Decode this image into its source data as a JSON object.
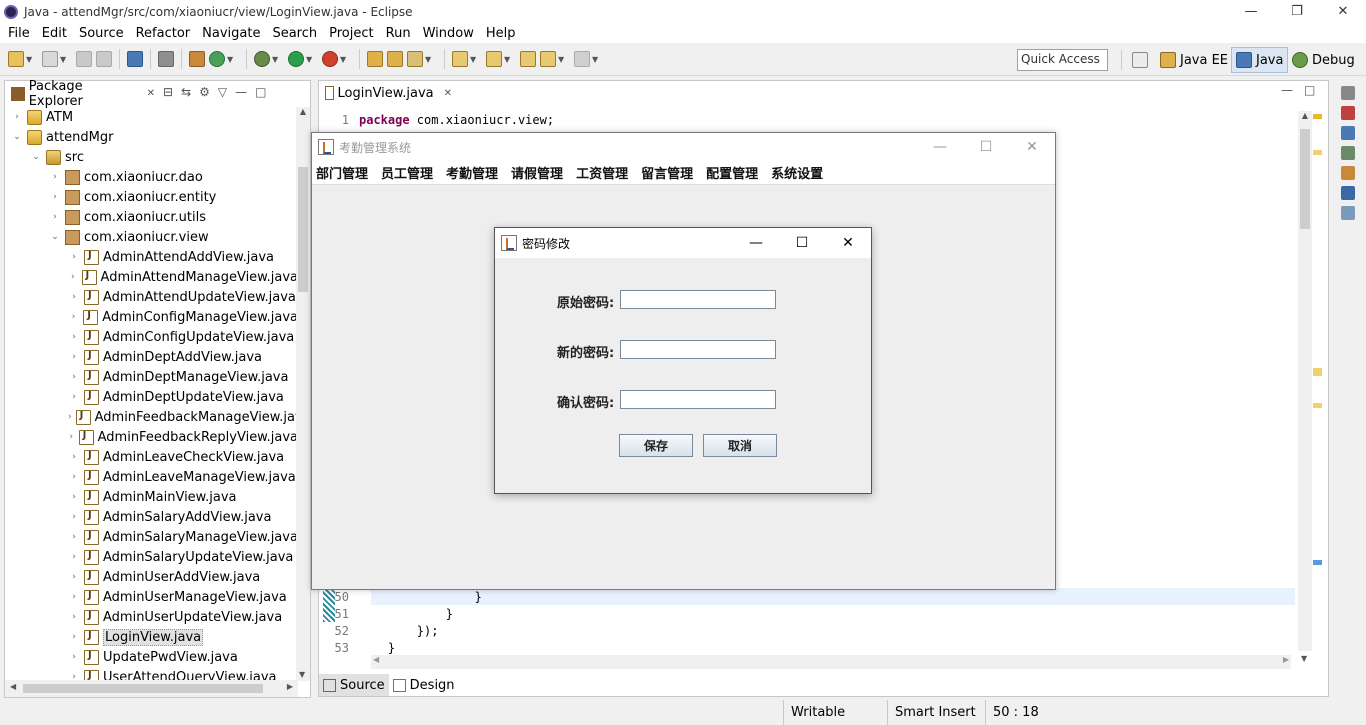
{
  "window": {
    "title": "Java - attendMgr/src/com/xiaoniucr/view/LoginView.java - Eclipse",
    "minimize": "—",
    "maximize": "❐",
    "close": "✕"
  },
  "menubar": [
    "File",
    "Edit",
    "Source",
    "Refactor",
    "Navigate",
    "Search",
    "Project",
    "Run",
    "Window",
    "Help"
  ],
  "toolbar": {
    "quick_access": "Quick Access"
  },
  "perspectives": [
    {
      "label": "Java EE"
    },
    {
      "label": "Java",
      "active": true
    },
    {
      "label": "Debug"
    }
  ],
  "package_explorer": {
    "tab_label": "Package Explorer",
    "tab_close": "✕",
    "tree": [
      {
        "label": "ATM",
        "type": "project",
        "level": 0,
        "expanded": false
      },
      {
        "label": "attendMgr",
        "type": "project",
        "level": 0,
        "expanded": true
      },
      {
        "label": "src",
        "type": "src",
        "level": 1,
        "expanded": true
      },
      {
        "label": "com.xiaoniucr.dao",
        "type": "package",
        "level": 2,
        "expanded": false
      },
      {
        "label": "com.xiaoniucr.entity",
        "type": "package",
        "level": 2,
        "expanded": false
      },
      {
        "label": "com.xiaoniucr.utils",
        "type": "package",
        "level": 2,
        "expanded": false
      },
      {
        "label": "com.xiaoniucr.view",
        "type": "package",
        "level": 2,
        "expanded": true
      },
      {
        "label": "AdminAttendAddView.java",
        "type": "java",
        "level": 3
      },
      {
        "label": "AdminAttendManageView.java",
        "type": "java",
        "level": 3
      },
      {
        "label": "AdminAttendUpdateView.java",
        "type": "java",
        "level": 3
      },
      {
        "label": "AdminConfigManageView.java",
        "type": "java",
        "level": 3
      },
      {
        "label": "AdminConfigUpdateView.java",
        "type": "java",
        "level": 3
      },
      {
        "label": "AdminDeptAddView.java",
        "type": "java",
        "level": 3
      },
      {
        "label": "AdminDeptManageView.java",
        "type": "java",
        "level": 3
      },
      {
        "label": "AdminDeptUpdateView.java",
        "type": "java",
        "level": 3
      },
      {
        "label": "AdminFeedbackManageView.jav",
        "type": "java",
        "level": 3
      },
      {
        "label": "AdminFeedbackReplyView.java",
        "type": "java",
        "level": 3
      },
      {
        "label": "AdminLeaveCheckView.java",
        "type": "java",
        "level": 3
      },
      {
        "label": "AdminLeaveManageView.java",
        "type": "java",
        "level": 3
      },
      {
        "label": "AdminMainView.java",
        "type": "java",
        "level": 3
      },
      {
        "label": "AdminSalaryAddView.java",
        "type": "java",
        "level": 3
      },
      {
        "label": "AdminSalaryManageView.java",
        "type": "java",
        "level": 3
      },
      {
        "label": "AdminSalaryUpdateView.java",
        "type": "java",
        "level": 3
      },
      {
        "label": "AdminUserAddView.java",
        "type": "java",
        "level": 3
      },
      {
        "label": "AdminUserManageView.java",
        "type": "java",
        "level": 3
      },
      {
        "label": "AdminUserUpdateView.java",
        "type": "java",
        "level": 3
      },
      {
        "label": "LoginView.java",
        "type": "java",
        "level": 3,
        "selected": true
      },
      {
        "label": "UpdatePwdView.java",
        "type": "java",
        "level": 3
      },
      {
        "label": "UserAttendQueryView.java",
        "type": "java",
        "level": 3
      }
    ]
  },
  "editor": {
    "tab_label": "LoginView.java",
    "tab_close": "✕",
    "first_line": {
      "num": "1",
      "keyword": "package",
      "rest": " com.xiaoniucr.view;"
    },
    "lines": [
      {
        "num": "50",
        "text": "                }"
      },
      {
        "num": "51",
        "text": "            }"
      },
      {
        "num": "52",
        "text": "        });"
      },
      {
        "num": "53",
        "text": "    }"
      }
    ],
    "bottom_tabs": [
      "Source",
      "Design"
    ]
  },
  "statusbar": {
    "writable": "Writable",
    "insert_mode": "Smart Insert",
    "position": "50 : 18"
  },
  "app_frame": {
    "title": "考勤管理系统",
    "menu": [
      "部门管理",
      "员工管理",
      "考勤管理",
      "请假管理",
      "工资管理",
      "留言管理",
      "配置管理",
      "系统设置"
    ]
  },
  "dialog": {
    "title": "密码修改",
    "fields": [
      {
        "label": "原始密码:",
        "value": ""
      },
      {
        "label": "新的密码:",
        "value": ""
      },
      {
        "label": "确认密码:",
        "value": ""
      }
    ],
    "save_label": "保存",
    "cancel_label": "取消"
  },
  "colors": {
    "keyword": "#7f0055",
    "selection": "#e1e1e1",
    "gutter_mark": "#2a8a9b"
  }
}
